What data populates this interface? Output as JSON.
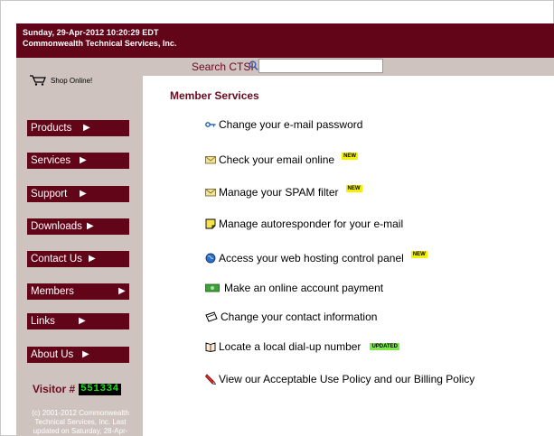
{
  "banner": {
    "date": "Sunday, 29-Apr-2012 10:20:29 EDT",
    "company": "Commonwealth Technical Services, Inc."
  },
  "search": {
    "label": "Search CTSI",
    "value": ""
  },
  "sidebar": {
    "shop_label": "Shop Online!",
    "nav": [
      {
        "label": "Products"
      },
      {
        "label": "Services"
      },
      {
        "label": "Support"
      },
      {
        "label": "Downloads"
      },
      {
        "label": "Contact Us"
      },
      {
        "label": "Members"
      },
      {
        "label": "Links"
      },
      {
        "label": "About Us"
      }
    ],
    "visitor_label": "Visitor #",
    "visitor_count": "551334",
    "copyright": "(c) 2001-2012 Commonwealth Technical Services, Inc. Last updated on Saturday, 28-Apr-"
  },
  "main": {
    "title": "Member Services",
    "items": [
      {
        "label": "Change your e-mail password",
        "icon": "key-icon",
        "badge": ""
      },
      {
        "label": "Check your email online",
        "icon": "envelope-icon",
        "badge": "NEW"
      },
      {
        "label": "Manage your SPAM filter",
        "icon": "envelope-icon",
        "badge": "NEW"
      },
      {
        "label": "Manage autoresponder for your e-mail",
        "icon": "note-icon",
        "badge": ""
      },
      {
        "label": "Access your web hosting control panel",
        "icon": "globe-icon",
        "badge": "NEW"
      },
      {
        "label": "Make an online account payment",
        "icon": "money-icon",
        "badge": ""
      },
      {
        "label": "Change your contact information",
        "icon": "card-icon",
        "badge": ""
      },
      {
        "label": "Locate a local dial-up number",
        "icon": "book-icon",
        "badge": "UPDATED"
      },
      {
        "label": "View our Acceptable Use Policy and our Billing Policy",
        "icon": "policy-icon",
        "badge": ""
      }
    ]
  },
  "colors": {
    "maroon": "#620519",
    "sidebar_bg": "#cfc3bf",
    "new_badge": "#f3f000",
    "updated_badge": "#7ce84a",
    "counter_text": "#18e218"
  }
}
